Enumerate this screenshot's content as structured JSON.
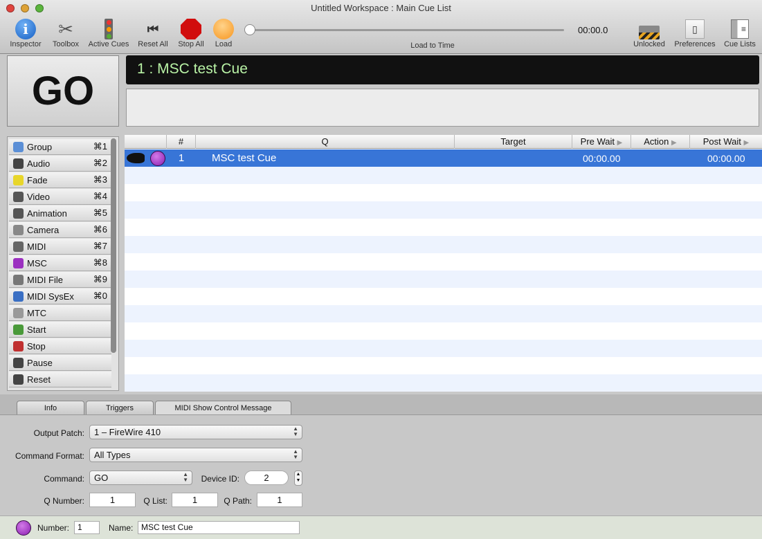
{
  "window": {
    "title": "Untitled Workspace : Main Cue List"
  },
  "toolbar": {
    "items": [
      {
        "label": "Inspector",
        "icon": "info-icon"
      },
      {
        "label": "Toolbox",
        "icon": "tools-icon"
      },
      {
        "label": "Active Cues",
        "icon": "traffic-light-icon"
      },
      {
        "label": "Reset All",
        "icon": "rewind-icon"
      },
      {
        "label": "Stop All",
        "icon": "stop-sign-icon"
      },
      {
        "label": "Load",
        "icon": "load-circle-icon"
      }
    ],
    "load_to_time_label": "Load to Time",
    "time": "00:00.0",
    "load_to_time_fraction": 0,
    "right_items": [
      {
        "label": "Unlocked",
        "icon": "padlock-open-icon"
      },
      {
        "label": "Preferences",
        "icon": "switch-icon"
      },
      {
        "label": "Cue Lists",
        "icon": "cue-lists-icon"
      }
    ]
  },
  "go": {
    "label": "GO"
  },
  "display": {
    "text": "1 : MSC test Cue"
  },
  "sidebar": {
    "items": [
      {
        "label": "Group",
        "key": "⌘1",
        "color": "#5b8fd6"
      },
      {
        "label": "Audio",
        "key": "⌘2",
        "color": "#444"
      },
      {
        "label": "Fade",
        "key": "⌘3",
        "color": "#e8d62a"
      },
      {
        "label": "Video",
        "key": "⌘4",
        "color": "#555"
      },
      {
        "label": "Animation",
        "key": "⌘5",
        "color": "#555"
      },
      {
        "label": "Camera",
        "key": "⌘6",
        "color": "#888"
      },
      {
        "label": "MIDI",
        "key": "⌘7",
        "color": "#666"
      },
      {
        "label": "MSC",
        "key": "⌘8",
        "color": "#9b30c0"
      },
      {
        "label": "MIDI File",
        "key": "⌘9",
        "color": "#777"
      },
      {
        "label": "MIDI SysEx",
        "key": "⌘0",
        "color": "#3a6fc4"
      },
      {
        "label": "MTC",
        "key": "",
        "color": "#999"
      },
      {
        "label": "Start",
        "key": "",
        "color": "#4a9a3a"
      },
      {
        "label": "Stop",
        "key": "",
        "color": "#c03030"
      },
      {
        "label": "Pause",
        "key": "",
        "color": "#444"
      },
      {
        "label": "Reset",
        "key": "",
        "color": "#444"
      }
    ]
  },
  "table": {
    "columns": {
      "number": "#",
      "q": "Q",
      "target": "Target",
      "pre_wait": "Pre Wait",
      "action": "Action",
      "post_wait": "Post Wait"
    },
    "rows": [
      {
        "number": "1",
        "q": "MSC test Cue",
        "target": "",
        "pre_wait": "00:00.00",
        "action": "",
        "post_wait": "00:00.00",
        "selected": true
      }
    ]
  },
  "inspector": {
    "tabs": [
      "Info",
      "Triggers",
      "MIDI Show Control Message"
    ],
    "active_tab": "MIDI Show Control Message",
    "output_patch_label": "Output Patch:",
    "output_patch": "1 – FireWire 410",
    "command_format_label": "Command Format:",
    "command_format": "All Types",
    "command_label": "Command:",
    "command": "GO",
    "device_id_label": "Device ID:",
    "device_id": "2",
    "q_number_label": "Q Number:",
    "q_number": "1",
    "q_list_label": "Q List:",
    "q_list": "1",
    "q_path_label": "Q Path:",
    "q_path": "1"
  },
  "footer": {
    "number_label": "Number:",
    "number": "1",
    "name_label": "Name:",
    "name": "MSC test Cue"
  }
}
